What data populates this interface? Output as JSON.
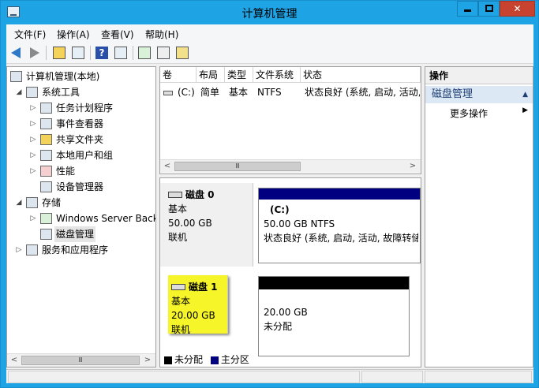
{
  "window": {
    "title": "计算机管理",
    "controls": {
      "minimize": "",
      "maximize": "",
      "close": "✕"
    }
  },
  "menu": [
    "文件(F)",
    "操作(A)",
    "查看(V)",
    "帮助(H)"
  ],
  "toolbar": {
    "icons": [
      "back-arrow-icon",
      "forward-arrow-icon",
      "up-folder-icon",
      "show-hide-tree-icon",
      "help-icon",
      "show-action-pane-icon",
      "refresh-icon",
      "properties-icon",
      "disk-settings-icon"
    ]
  },
  "tree": {
    "items": [
      {
        "label": "计算机管理(本地)",
        "level": 0,
        "expander": ""
      },
      {
        "label": "系统工具",
        "level": 1,
        "expander": "◢"
      },
      {
        "label": "任务计划程序",
        "level": 2,
        "expander": "▷"
      },
      {
        "label": "事件查看器",
        "level": 2,
        "expander": "▷"
      },
      {
        "label": "共享文件夹",
        "level": 2,
        "expander": "▷"
      },
      {
        "label": "本地用户和组",
        "level": 2,
        "expander": "▷"
      },
      {
        "label": "性能",
        "level": 2,
        "expander": "▷"
      },
      {
        "label": "设备管理器",
        "level": 2,
        "expander": ""
      },
      {
        "label": "存储",
        "level": 1,
        "expander": "◢"
      },
      {
        "label": "Windows Server Back",
        "level": 2,
        "expander": "▷"
      },
      {
        "label": "磁盘管理",
        "level": 2,
        "expander": "",
        "selected": true
      },
      {
        "label": "服务和应用程序",
        "level": 1,
        "expander": "▷"
      }
    ]
  },
  "volumes": {
    "columns": [
      "卷",
      "布局",
      "类型",
      "文件系统",
      "状态"
    ],
    "rows": [
      {
        "volume": "(C:)",
        "layout": "简单",
        "type": "基本",
        "fs": "NTFS",
        "status": "状态良好 (系统, 启动, 活动,"
      }
    ]
  },
  "disks": [
    {
      "name": "磁盘 0",
      "type": "基本",
      "size": "50.00 GB",
      "state": "联机",
      "partition": {
        "title": "(C:)",
        "line1": "50.00 GB NTFS",
        "line2": "状态良好 (系统, 启动, 活动, 故障转储"
      }
    },
    {
      "name": "磁盘 1",
      "type": "基本",
      "size": "20.00 GB",
      "state": "联机",
      "partition": {
        "title": "",
        "line1": "20.00 GB",
        "line2": "未分配"
      }
    }
  ],
  "legend": [
    {
      "label": "未分配",
      "color": "#000000"
    },
    {
      "label": "主分区",
      "color": "#000080"
    }
  ],
  "actions": {
    "title": "操作",
    "section": "磁盘管理",
    "more": "更多操作"
  },
  "scroll": {
    "thumb_glyph": "Ⅲ",
    "left_arrow": "<",
    "right_arrow": ">"
  }
}
